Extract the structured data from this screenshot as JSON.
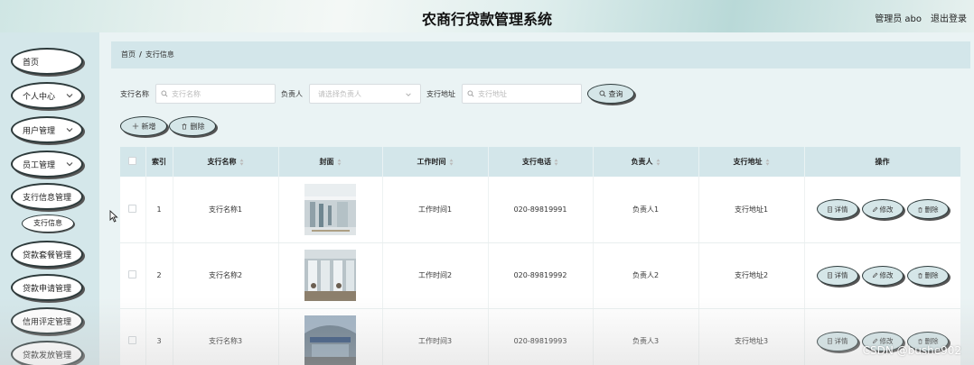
{
  "header": {
    "title": "农商行贷款管理系统",
    "admin": "管理员 abo",
    "logout": "退出登录"
  },
  "sidebar": {
    "items": [
      {
        "label": "首页",
        "chevron": false
      },
      {
        "label": "个人中心",
        "chevron": true
      },
      {
        "label": "用户管理",
        "chevron": true
      },
      {
        "label": "员工管理",
        "chevron": true
      },
      {
        "label": "支行信息管理",
        "chevron": false
      },
      {
        "label": "贷款套餐管理",
        "chevron": false
      },
      {
        "label": "贷款申请管理",
        "chevron": false
      },
      {
        "label": "信用评定管理",
        "chevron": false
      },
      {
        "label": "贷款发放管理",
        "chevron": false
      }
    ],
    "sub_item": "支行信息"
  },
  "breadcrumb": {
    "home": "首页",
    "separator": "/",
    "current": "支行信息"
  },
  "search": {
    "name_label": "支行名称",
    "name_placeholder": "支行名称",
    "manager_label": "负责人",
    "manager_placeholder": "请选择负责人",
    "address_label": "支行地址",
    "address_placeholder": "支行地址",
    "query_label": "查询"
  },
  "toolbar": {
    "add_label": "新增",
    "delete_label": "删除"
  },
  "table": {
    "headers": [
      "索引",
      "支行名称",
      "封面",
      "工作时间",
      "支行电话",
      "负责人",
      "支行地址",
      "操作"
    ],
    "rows": [
      {
        "index": "1",
        "name": "支行名称1",
        "time": "工作时间1",
        "phone": "020-89819991",
        "manager": "负责人1",
        "address": "支行地址1"
      },
      {
        "index": "2",
        "name": "支行名称2",
        "time": "工作时间2",
        "phone": "020-89819992",
        "manager": "负责人2",
        "address": "支行地址2"
      },
      {
        "index": "3",
        "name": "支行名称3",
        "time": "工作时间3",
        "phone": "020-89819993",
        "manager": "负责人3",
        "address": "支行地址3"
      }
    ],
    "ops": {
      "detail": "详情",
      "edit": "修改",
      "delete": "删除"
    }
  },
  "watermark": "CSDN @bushe902",
  "colors": {
    "accent_bg": "#d3e6ea",
    "border_dark": "#2d3a3b"
  }
}
